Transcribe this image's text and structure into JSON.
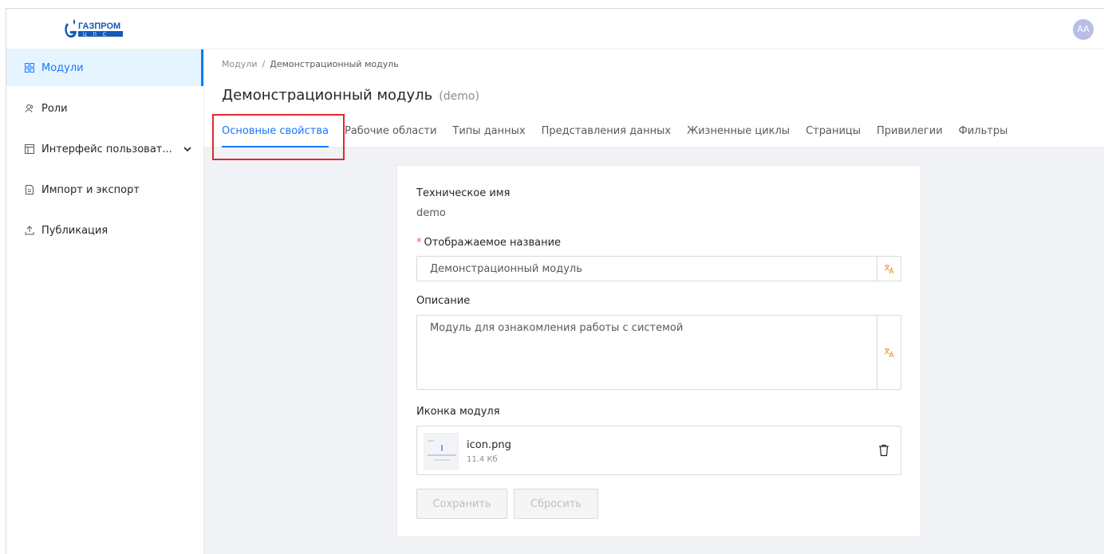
{
  "header": {
    "logo_text": "ГАЗПРОМ",
    "logo_sub": "ЦПС",
    "avatar_initials": "AA"
  },
  "sidebar": {
    "items": [
      {
        "label": "Модули",
        "icon": "grid-icon",
        "active": true
      },
      {
        "label": "Роли",
        "icon": "users-icon",
        "active": false
      },
      {
        "label": "Интерфейс пользоват...",
        "icon": "layout-icon",
        "active": false,
        "has_chevron": true
      },
      {
        "label": "Импорт и экспорт",
        "icon": "file-icon",
        "active": false
      },
      {
        "label": "Публикация",
        "icon": "upload-icon",
        "active": false
      }
    ]
  },
  "breadcrumb": {
    "root": "Модули",
    "separator": "/",
    "current": "Демонстрационный модуль"
  },
  "page": {
    "title": "Демонстрационный модуль",
    "subtitle": "(demo)"
  },
  "tabs": [
    {
      "label": "Основные свойства",
      "active": true
    },
    {
      "label": "Рабочие области",
      "active": false
    },
    {
      "label": "Типы данных",
      "active": false
    },
    {
      "label": "Представления данных",
      "active": false
    },
    {
      "label": "Жизненные циклы",
      "active": false
    },
    {
      "label": "Страницы",
      "active": false
    },
    {
      "label": "Привилегии",
      "active": false
    },
    {
      "label": "Фильтры",
      "active": false
    }
  ],
  "form": {
    "tech_name_label": "Техническое имя",
    "tech_name_value": "demo",
    "display_name_label": "Отображаемое название",
    "display_name_required_mark": "*",
    "display_name_value": "Демонстрационный модуль",
    "description_label": "Описание",
    "description_value": "Модуль для ознакомления работы с системой",
    "icon_label": "Иконка модуля",
    "file": {
      "name": "icon.png",
      "size": "11.4 Кб"
    },
    "save_label": "Сохранить",
    "reset_label": "Сбросить"
  },
  "colors": {
    "accent": "#1677ff",
    "highlight_border": "#e0282e",
    "translate_icon": "#e6a23c"
  }
}
